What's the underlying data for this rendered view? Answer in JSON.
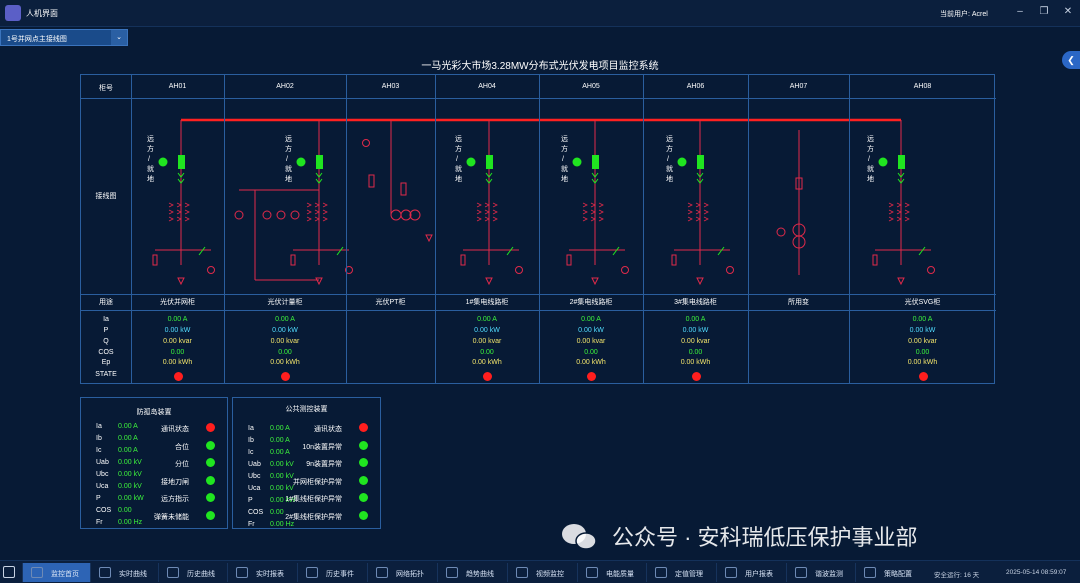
{
  "app": {
    "title": "人机界面",
    "current_user": "当前用户: Acrel",
    "selector": "1号并网点主接线图"
  },
  "system_title": "一马光彩大市场3.28MW分布式光伏发电项目监控系统",
  "row_labels": {
    "cabinet": "柜号",
    "diagram": "接线图",
    "usage": "用途",
    "ia": "Ia",
    "p": "P",
    "q": "Q",
    "cos": "COS",
    "ep": "Ep",
    "state": "STATE"
  },
  "remote_local": "远方/就地",
  "cabinets": [
    {
      "id": "AH01",
      "usage": "光伏并网柜",
      "ia": "0.00 A",
      "p": "0.00 kW",
      "q": "0.00 kvar",
      "cos": "0.00",
      "ep": "0.00 kWh",
      "state": "red"
    },
    {
      "id": "AH02",
      "usage": "光伏计量柜",
      "ia": "0.00 A",
      "p": "0.00 kW",
      "q": "0.00 kvar",
      "cos": "0.00",
      "ep": "0.00 kWh",
      "state": "red"
    },
    {
      "id": "AH03",
      "usage": "光伏PT柜"
    },
    {
      "id": "AH04",
      "usage": "1#集电线路柜",
      "ia": "0.00 A",
      "p": "0.00 kW",
      "q": "0.00 kvar",
      "cos": "0.00",
      "ep": "0.00 kWh",
      "state": "red"
    },
    {
      "id": "AH05",
      "usage": "2#集电线路柜",
      "ia": "0.00 A",
      "p": "0.00 kW",
      "q": "0.00 kvar",
      "cos": "0.00",
      "ep": "0.00 kWh",
      "state": "red"
    },
    {
      "id": "AH06",
      "usage": "3#集电线路柜",
      "ia": "0.00 A",
      "p": "0.00 kW",
      "q": "0.00 kvar",
      "cos": "0.00",
      "ep": "0.00 kWh",
      "state": "red"
    },
    {
      "id": "AH07",
      "usage": "所用变"
    },
    {
      "id": "AH08",
      "usage": "光伏SVG柜",
      "ia": "0.00 A",
      "p": "0.00 kW",
      "q": "0.00 kvar",
      "cos": "0.00",
      "ep": "0.00 kWh",
      "state": "red"
    }
  ],
  "anti_island": {
    "title": "防孤岛装置",
    "measures": [
      {
        "k": "Ia",
        "v": "0.00 A"
      },
      {
        "k": "Ib",
        "v": "0.00 A"
      },
      {
        "k": "Ic",
        "v": "0.00 A"
      },
      {
        "k": "Uab",
        "v": "0.00 kV"
      },
      {
        "k": "Ubc",
        "v": "0.00 kV"
      },
      {
        "k": "Uca",
        "v": "0.00 kV"
      },
      {
        "k": "P",
        "v": "0.00 kW"
      },
      {
        "k": "COS",
        "v": "0.00"
      },
      {
        "k": "Fr",
        "v": "0.00 Hz"
      }
    ],
    "states": [
      {
        "k": "通讯状态",
        "c": "red"
      },
      {
        "k": "合位",
        "c": "green"
      },
      {
        "k": "分位",
        "c": "green"
      },
      {
        "k": "接地刀闸",
        "c": "green"
      },
      {
        "k": "远方指示",
        "c": "green"
      },
      {
        "k": "弹簧未储能",
        "c": "green"
      }
    ]
  },
  "public_meas": {
    "title": "公共测控装置",
    "measures": [
      {
        "k": "Ia",
        "v": "0.00 A"
      },
      {
        "k": "Ib",
        "v": "0.00 A"
      },
      {
        "k": "Ic",
        "v": "0.00 A"
      },
      {
        "k": "Uab",
        "v": "0.00 kV"
      },
      {
        "k": "Ubc",
        "v": "0.00 kV"
      },
      {
        "k": "Uca",
        "v": "0.00 kV"
      },
      {
        "k": "P",
        "v": "0.00 kW"
      },
      {
        "k": "COS",
        "v": "0.00"
      },
      {
        "k": "Fr",
        "v": "0.00 Hz"
      }
    ],
    "states": [
      {
        "k": "通讯状态",
        "c": "red"
      },
      {
        "k": "10n装置异常",
        "c": "green"
      },
      {
        "k": "9n装置异常",
        "c": "green"
      },
      {
        "k": "并网柜保护异常",
        "c": "green"
      },
      {
        "k": "1#集线柜保护异常",
        "c": "green"
      },
      {
        "k": "2#集线柜保护异常",
        "c": "green"
      }
    ]
  },
  "nav": [
    "监控首页",
    "实时曲线",
    "历史曲线",
    "实时报表",
    "历史事件",
    "网络拓扑",
    "趋势曲线",
    "视频监控",
    "电能质量",
    "定值管理",
    "用户报表",
    "谐波监测",
    "策略配置"
  ],
  "status": {
    "safe_run": "安全运行: 16 天",
    "datetime": "2025-05-14 08:59:07"
  },
  "watermark": "公众号 · 安科瑞低压保护事业部",
  "colors": {
    "bus": "#ff2020",
    "line": "#e02a4a",
    "green_device": "#20e520"
  }
}
